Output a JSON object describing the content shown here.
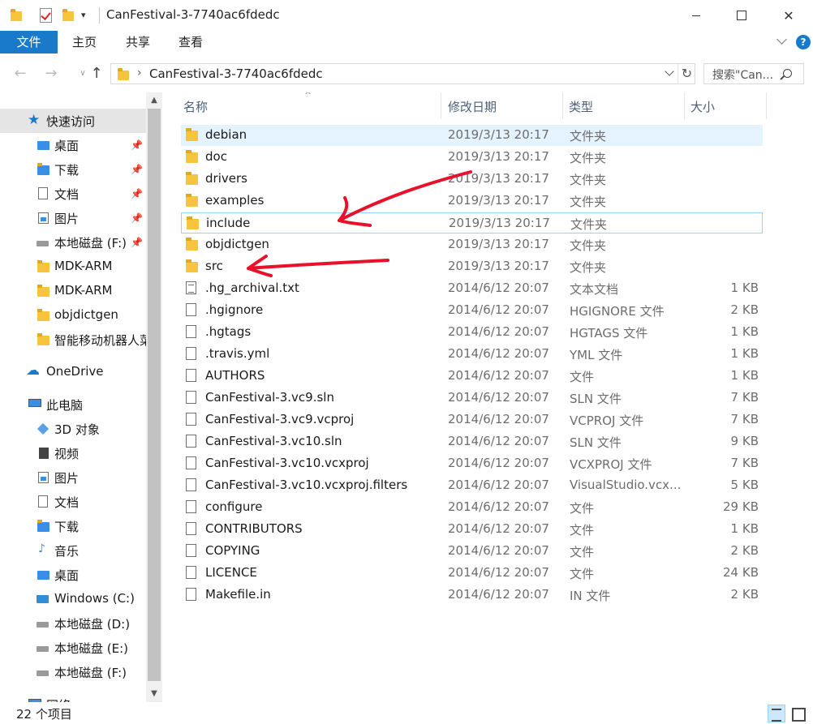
{
  "window": {
    "title": "CanFestival-3-7740ac6fdedc",
    "quick_access_dropdown": "▾",
    "min_label": "",
    "max_label": "",
    "close_label": "✕"
  },
  "ribbon": {
    "tabs": [
      {
        "label": "文件"
      },
      {
        "label": "主页"
      },
      {
        "label": "共享"
      },
      {
        "label": "查看"
      }
    ],
    "help": "?"
  },
  "address": {
    "separator": "›",
    "path": "CanFestival-3-7740ac6fdedc",
    "refresh": "↻",
    "back": "←",
    "forward": "→",
    "recent": "∨",
    "up": "↑"
  },
  "search": {
    "placeholder": "搜索\"Can..."
  },
  "sidebar": {
    "scroll_up": "▲",
    "scroll_down": "▼",
    "items": [
      {
        "label": "快速访问",
        "icon": "star-icon"
      },
      {
        "label": "桌面",
        "icon": "desktop-icon",
        "pinned": true
      },
      {
        "label": "下载",
        "icon": "download-icon",
        "pinned": true
      },
      {
        "label": "文档",
        "icon": "document-icon",
        "pinned": true
      },
      {
        "label": "图片",
        "icon": "picture-icon",
        "pinned": true
      },
      {
        "label": "本地磁盘 (F:)",
        "icon": "drive-icon",
        "pinned": true
      },
      {
        "label": "MDK-ARM",
        "icon": "folder-icon"
      },
      {
        "label": "MDK-ARM",
        "icon": "folder-icon"
      },
      {
        "label": "objdictgen",
        "icon": "folder-icon"
      },
      {
        "label": "智能移动机器人菜",
        "icon": "folder-icon"
      },
      {
        "label": "OneDrive",
        "icon": "cloud-icon"
      },
      {
        "label": "此电脑",
        "icon": "computer-icon"
      },
      {
        "label": "3D 对象",
        "icon": "3d-objects-icon"
      },
      {
        "label": "视频",
        "icon": "video-icon"
      },
      {
        "label": "图片",
        "icon": "picture-icon"
      },
      {
        "label": "文档",
        "icon": "document-icon"
      },
      {
        "label": "下载",
        "icon": "download-icon"
      },
      {
        "label": "音乐",
        "icon": "music-icon"
      },
      {
        "label": "桌面",
        "icon": "desktop-icon"
      },
      {
        "label": "Windows (C:)",
        "icon": "windows-drive-icon"
      },
      {
        "label": "本地磁盘 (D:)",
        "icon": "drive-icon"
      },
      {
        "label": "本地磁盘 (E:)",
        "icon": "drive-icon"
      },
      {
        "label": "本地磁盘 (F:)",
        "icon": "drive-icon"
      },
      {
        "label": "网络",
        "icon": "network-icon"
      }
    ]
  },
  "columns": {
    "name": "名称",
    "date": "修改日期",
    "type": "类型",
    "size": "大小",
    "sort_caret": "^"
  },
  "files": [
    {
      "name": "debian",
      "date": "2019/3/13 20:17",
      "type": "文件夹",
      "size": "",
      "kind": "folder"
    },
    {
      "name": "doc",
      "date": "2019/3/13 20:17",
      "type": "文件夹",
      "size": "",
      "kind": "folder"
    },
    {
      "name": "drivers",
      "date": "2019/3/13 20:17",
      "type": "文件夹",
      "size": "",
      "kind": "folder"
    },
    {
      "name": "examples",
      "date": "2019/3/13 20:17",
      "type": "文件夹",
      "size": "",
      "kind": "folder"
    },
    {
      "name": "include",
      "date": "2019/3/13 20:17",
      "type": "文件夹",
      "size": "",
      "kind": "folder"
    },
    {
      "name": "objdictgen",
      "date": "2019/3/13 20:17",
      "type": "文件夹",
      "size": "",
      "kind": "folder"
    },
    {
      "name": "src",
      "date": "2019/3/13 20:17",
      "type": "文件夹",
      "size": "",
      "kind": "folder"
    },
    {
      "name": ".hg_archival.txt",
      "date": "2014/6/12 20:07",
      "type": "文本文档",
      "size": "1 KB",
      "kind": "text"
    },
    {
      "name": ".hgignore",
      "date": "2014/6/12 20:07",
      "type": "HGIGNORE 文件",
      "size": "2 KB",
      "kind": "doc"
    },
    {
      "name": ".hgtags",
      "date": "2014/6/12 20:07",
      "type": "HGTAGS 文件",
      "size": "1 KB",
      "kind": "doc"
    },
    {
      "name": ".travis.yml",
      "date": "2014/6/12 20:07",
      "type": "YML 文件",
      "size": "1 KB",
      "kind": "doc"
    },
    {
      "name": "AUTHORS",
      "date": "2014/6/12 20:07",
      "type": "文件",
      "size": "1 KB",
      "kind": "doc"
    },
    {
      "name": "CanFestival-3.vc9.sln",
      "date": "2014/6/12 20:07",
      "type": "SLN 文件",
      "size": "7 KB",
      "kind": "doc"
    },
    {
      "name": "CanFestival-3.vc9.vcproj",
      "date": "2014/6/12 20:07",
      "type": "VCPROJ 文件",
      "size": "7 KB",
      "kind": "doc"
    },
    {
      "name": "CanFestival-3.vc10.sln",
      "date": "2014/6/12 20:07",
      "type": "SLN 文件",
      "size": "9 KB",
      "kind": "doc"
    },
    {
      "name": "CanFestival-3.vc10.vcxproj",
      "date": "2014/6/12 20:07",
      "type": "VCXPROJ 文件",
      "size": "7 KB",
      "kind": "doc"
    },
    {
      "name": "CanFestival-3.vc10.vcxproj.filters",
      "date": "2014/6/12 20:07",
      "type": "VisualStudio.vcx...",
      "size": "5 KB",
      "kind": "doc"
    },
    {
      "name": "configure",
      "date": "2014/6/12 20:07",
      "type": "文件",
      "size": "29 KB",
      "kind": "doc"
    },
    {
      "name": "CONTRIBUTORS",
      "date": "2014/6/12 20:07",
      "type": "文件",
      "size": "1 KB",
      "kind": "doc"
    },
    {
      "name": "COPYING",
      "date": "2014/6/12 20:07",
      "type": "文件",
      "size": "2 KB",
      "kind": "doc"
    },
    {
      "name": "LICENCE",
      "date": "2014/6/12 20:07",
      "type": "文件",
      "size": "24 KB",
      "kind": "doc"
    },
    {
      "name": "Makefile.in",
      "date": "2014/6/12 20:07",
      "type": "IN 文件",
      "size": "2 KB",
      "kind": "doc"
    }
  ],
  "status": {
    "count": "22 个项目"
  },
  "colors": {
    "accent": "#1979ca",
    "annotation_arrow": "#e8102a",
    "row_hover": "#e5f3ff",
    "row_focus_border": "#99d1ff"
  }
}
